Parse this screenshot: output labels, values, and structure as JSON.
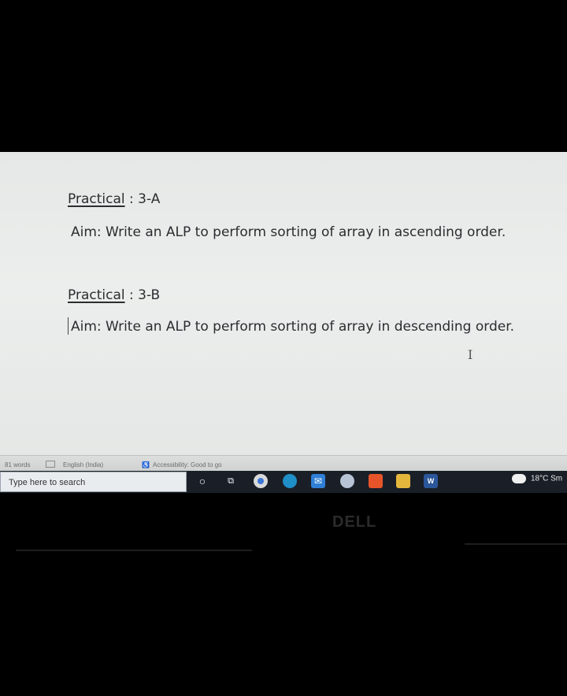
{
  "document": {
    "practical_a": {
      "label": "Practical",
      "value": " : 3-A",
      "aim": "Aim: Write an ALP to perform sorting of array in ascending order."
    },
    "practical_b": {
      "label": "Practical",
      "value": " : 3-B",
      "aim": "Aim: Write an ALP to perform sorting of array in descending order."
    }
  },
  "statusbar": {
    "words": "81 words",
    "language": "English (India)",
    "accessibility": "Accessibility: Good to go"
  },
  "taskbar": {
    "search_placeholder": "Type here to search",
    "weather": "18°C  Sm"
  },
  "laptop": {
    "brand": "DELL"
  },
  "colors": {
    "doc_bg": "#eceeed",
    "taskbar_bg": "#1a1f27"
  }
}
